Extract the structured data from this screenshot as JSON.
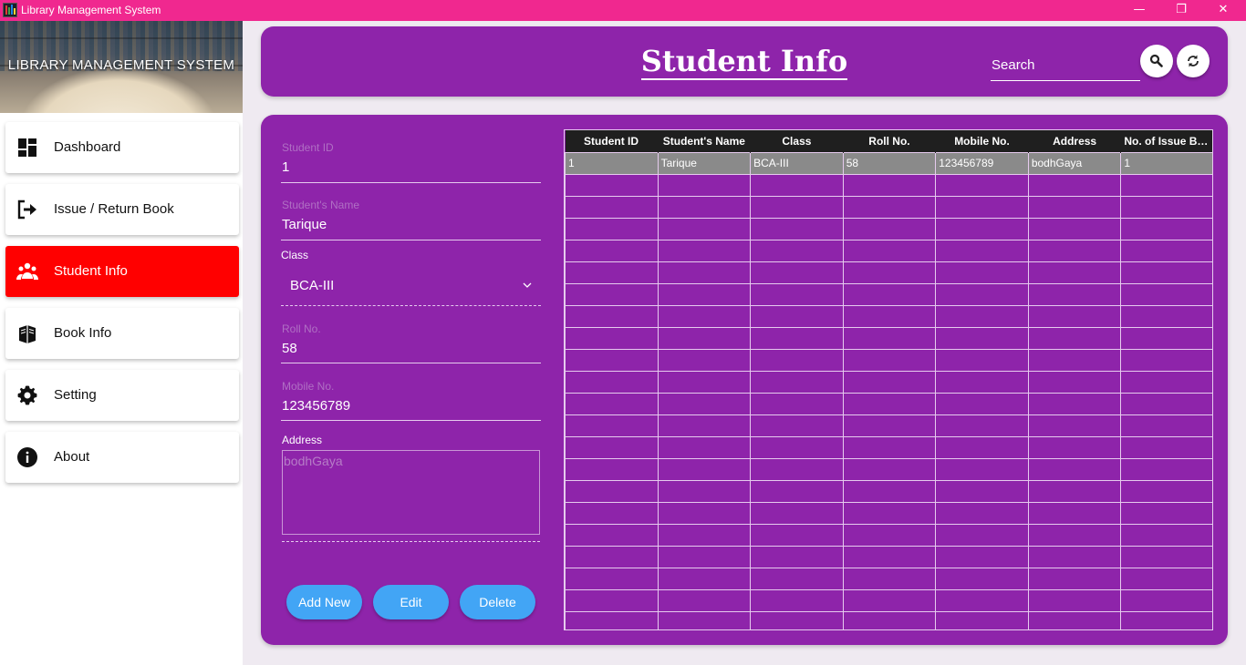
{
  "window": {
    "title": "Library Management System",
    "minimize_glyph": "—",
    "restore_glyph": "❐",
    "close_glyph": "✕"
  },
  "sidebar": {
    "banner_text": "LIBRARY MANAGEMENT SYSTEM",
    "items": [
      {
        "label": "Dashboard",
        "icon": "dashboard-icon",
        "active": false
      },
      {
        "label": "Issue / Return Book",
        "icon": "exit-icon",
        "active": false
      },
      {
        "label": "Student Info",
        "icon": "students-icon",
        "active": true
      },
      {
        "label": "Book Info",
        "icon": "books-icon",
        "active": false
      },
      {
        "label": "Setting",
        "icon": "gear-icon",
        "active": false
      },
      {
        "label": "About",
        "icon": "info-icon",
        "active": false
      }
    ]
  },
  "header": {
    "title": "Student Info",
    "search_placeholder": "Search"
  },
  "form": {
    "student_id": {
      "label": "Student ID",
      "value": "1"
    },
    "student_name": {
      "label": "Student's Name",
      "value": "Tarique"
    },
    "class": {
      "label": "Class",
      "value": "BCA-III"
    },
    "roll_no": {
      "label": "Roll No.",
      "value": "58"
    },
    "mobile_no": {
      "label": "Mobile No.",
      "value": "123456789"
    },
    "address": {
      "label": "Address",
      "value": "bodhGaya"
    }
  },
  "buttons": {
    "add_new": "Add New",
    "edit": "Edit",
    "delete": "Delete"
  },
  "table": {
    "columns": [
      "Student ID",
      "Student's Name",
      "Class",
      "Roll No.",
      "Mobile No.",
      "Address",
      "No. of Issue Bo..."
    ],
    "rows": [
      [
        "1",
        "Tarique",
        "BCA-III",
        "58",
        "123456789",
        "bodhGaya",
        "1"
      ]
    ]
  },
  "colors": {
    "titlebar": "#f0288f",
    "card": "#8e24aa",
    "active_nav": "#ff0000",
    "button": "#42a5f5",
    "selected_row": "#8a8a8a"
  }
}
